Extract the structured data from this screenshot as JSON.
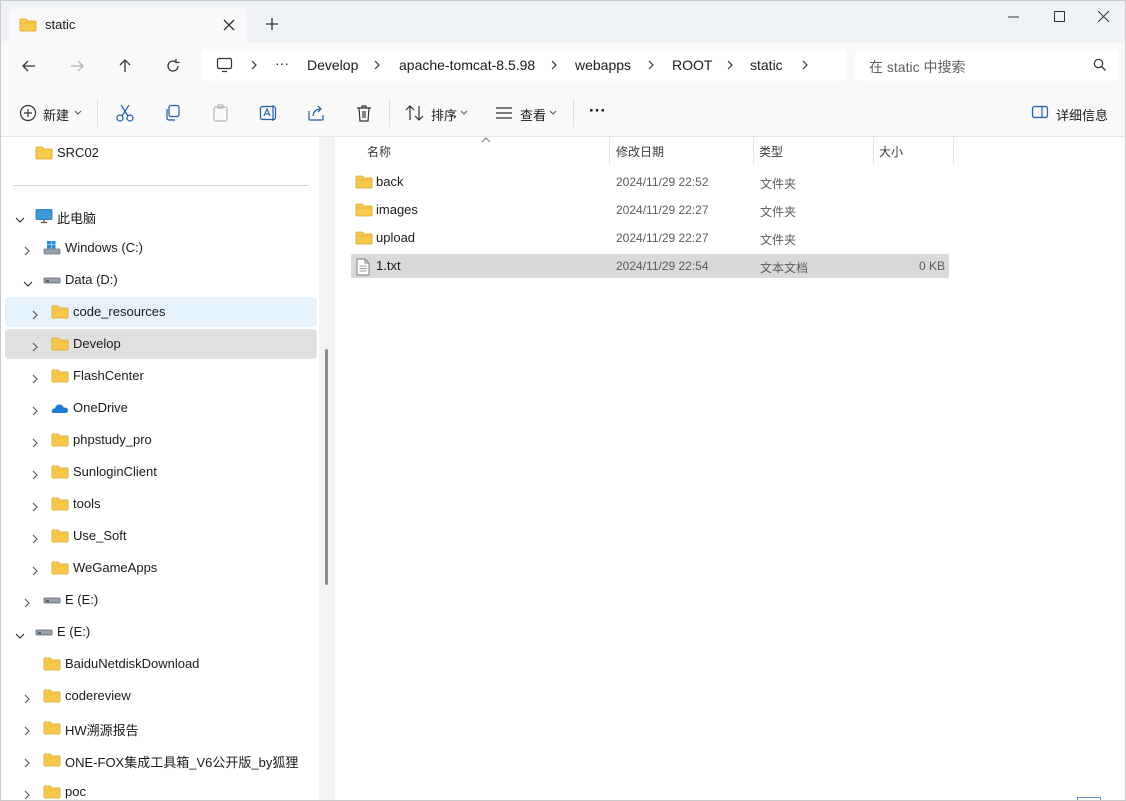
{
  "tab": {
    "title": "static",
    "new_tab_symbol": "+"
  },
  "window_controls": {
    "minimize": "minimize-icon",
    "maximize": "maximize-icon",
    "close": "close-icon"
  },
  "nav_buttons": [
    "back-icon",
    "forward-icon",
    "up-icon",
    "refresh-icon"
  ],
  "breadcrumb": {
    "more": "···",
    "items": [
      "Develop",
      "apache-tomcat-8.5.98",
      "webapps",
      "ROOT",
      "static"
    ]
  },
  "search": {
    "placeholder": "在 static 中搜索"
  },
  "toolbar": {
    "new_label": "新建",
    "sort_label": "排序",
    "view_label": "查看",
    "more_label": "···",
    "details_label": "详细信息"
  },
  "sidebar": {
    "top_item": "SRC02",
    "items": [
      {
        "label": "此电脑",
        "icon": "pc-icon",
        "expanded": true
      },
      {
        "label": "Windows (C:)",
        "icon": "windows-drive-icon"
      },
      {
        "label": "Data (D:)",
        "icon": "drive-icon",
        "expanded": true
      },
      {
        "label": "code_resources",
        "icon": "folder-icon"
      },
      {
        "label": "Develop",
        "icon": "folder-icon",
        "selected": true
      },
      {
        "label": "FlashCenter",
        "icon": "folder-icon"
      },
      {
        "label": "OneDrive",
        "icon": "onedrive-icon"
      },
      {
        "label": "phpstudy_pro",
        "icon": "folder-icon"
      },
      {
        "label": "SunloginClient",
        "icon": "folder-icon"
      },
      {
        "label": "tools",
        "icon": "folder-icon"
      },
      {
        "label": "Use_Soft",
        "icon": "folder-icon"
      },
      {
        "label": "WeGameApps",
        "icon": "folder-icon"
      },
      {
        "label": "E (E:)",
        "icon": "drive-icon"
      },
      {
        "label": "E (E:)",
        "icon": "drive-icon",
        "expanded": true
      },
      {
        "label": "BaiduNetdiskDownload",
        "icon": "folder-icon"
      },
      {
        "label": "codereview",
        "icon": "folder-icon"
      },
      {
        "label": "HW溯源报告",
        "icon": "folder-icon"
      },
      {
        "label": "ONE-FOX集成工具箱_V6公开版_by狐狸",
        "icon": "folder-icon"
      },
      {
        "label": "poc",
        "icon": "folder-icon"
      }
    ]
  },
  "columns": {
    "name": "名称",
    "date": "修改日期",
    "type": "类型",
    "size": "大小"
  },
  "files": [
    {
      "name": "back",
      "date": "2024/11/29 22:52",
      "type": "文件夹",
      "size": "",
      "icon": "folder-icon"
    },
    {
      "name": "images",
      "date": "2024/11/29 22:27",
      "type": "文件夹",
      "size": "",
      "icon": "folder-icon"
    },
    {
      "name": "upload",
      "date": "2024/11/29 22:27",
      "type": "文件夹",
      "size": "",
      "icon": "folder-icon"
    },
    {
      "name": "1.txt",
      "date": "2024/11/29 22:54",
      "type": "文本文档",
      "size": "0 KB",
      "icon": "text-file-icon",
      "selected": true
    }
  ],
  "colors": {
    "folder": "#f8c94a",
    "selection": "#d9d9d9",
    "hover": "#e5f1fb",
    "accent": "#0067c0"
  }
}
